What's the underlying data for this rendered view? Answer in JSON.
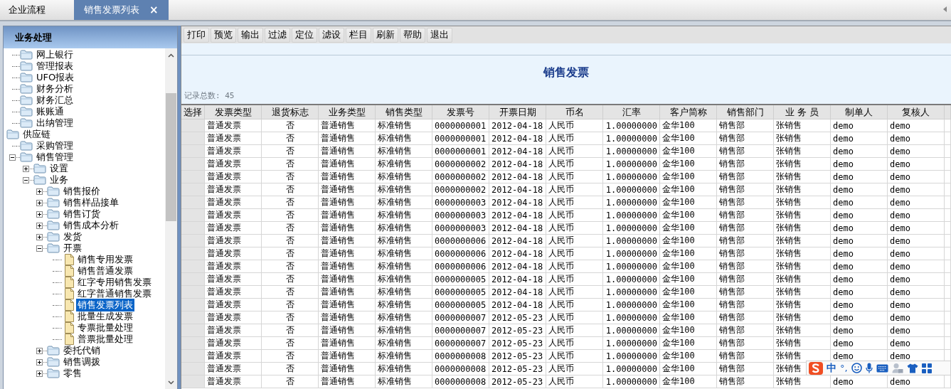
{
  "tabs": [
    {
      "label": "企业流程",
      "selected": false
    },
    {
      "label": "销售发票列表",
      "selected": true,
      "close": "×"
    }
  ],
  "sidebar": {
    "title": "业务处理",
    "continued_items": [
      {
        "label": "网上银行",
        "kind": "folder",
        "selected": false
      },
      {
        "label": "管理报表",
        "kind": "folder",
        "selected": false
      },
      {
        "label": "UFO报表",
        "kind": "folder",
        "selected": false
      },
      {
        "label": "财务分析",
        "kind": "folder",
        "selected": false
      },
      {
        "label": "财务汇总",
        "kind": "folder",
        "selected": false
      },
      {
        "label": "账账通",
        "kind": "folder",
        "selected": false
      },
      {
        "label": "出纳管理",
        "kind": "folder",
        "selected": false
      }
    ],
    "items": [
      {
        "label": "供应链",
        "kind": "folder",
        "selected": false,
        "children": [
          {
            "label": "采购管理",
            "kind": "folder",
            "selected": false
          },
          {
            "label": "销售管理",
            "kind": "folder",
            "selected": false,
            "expanded": true,
            "children": [
              {
                "label": "设置",
                "kind": "folder",
                "selected": false,
                "expanded": false
              },
              {
                "label": "业务",
                "kind": "folder",
                "selected": false,
                "expanded": true,
                "children": [
                  {
                    "label": "销售报价",
                    "kind": "folder",
                    "selected": false,
                    "expanded": false
                  },
                  {
                    "label": "销售样品接单",
                    "kind": "folder",
                    "selected": false,
                    "expanded": false
                  },
                  {
                    "label": "销售订货",
                    "kind": "folder",
                    "selected": false,
                    "expanded": false
                  },
                  {
                    "label": "销售成本分析",
                    "kind": "folder",
                    "selected": false,
                    "expanded": false
                  },
                  {
                    "label": "发货",
                    "kind": "folder",
                    "selected": false,
                    "expanded": false
                  },
                  {
                    "label": "开票",
                    "kind": "folder",
                    "selected": false,
                    "expanded": true,
                    "children": [
                      {
                        "label": "销售专用发票",
                        "kind": "document",
                        "selected": false
                      },
                      {
                        "label": "销售普通发票",
                        "kind": "document",
                        "selected": false
                      },
                      {
                        "label": "红字专用销售发票",
                        "kind": "document",
                        "selected": false
                      },
                      {
                        "label": "红字普通销售发票",
                        "kind": "document",
                        "selected": false
                      },
                      {
                        "label": "销售发票列表",
                        "kind": "document",
                        "selected": true
                      },
                      {
                        "label": "批量生成发票",
                        "kind": "document",
                        "selected": false
                      },
                      {
                        "label": "专票批量处理",
                        "kind": "document",
                        "selected": false
                      },
                      {
                        "label": "普票批量处理",
                        "kind": "document",
                        "selected": false
                      }
                    ]
                  },
                  {
                    "label": "委托代销",
                    "kind": "folder",
                    "selected": false,
                    "expanded": false
                  },
                  {
                    "label": "销售调拨",
                    "kind": "folder",
                    "selected": false,
                    "expanded": false
                  },
                  {
                    "label": "零售",
                    "kind": "folder",
                    "selected": false,
                    "expanded": false
                  }
                ]
              }
            ]
          }
        ]
      }
    ]
  },
  "toolbar": [
    "打印",
    "预览",
    "输出",
    "过滤",
    "定位",
    "滤设",
    "栏目",
    "刷新",
    "帮助",
    "退出"
  ],
  "report": {
    "title": "销售发票",
    "record_count": "记录总数: 45"
  },
  "table": {
    "selector_header": "选择",
    "columns": [
      "发票类型",
      "退货标志",
      "业务类型",
      "销售类型",
      "发票号",
      "开票日期",
      "币名",
      "汇率",
      "客户简称",
      "销售部门",
      "业 务 员",
      "制单人",
      "复核人"
    ],
    "rows": [
      [
        "普通发票",
        "否",
        "普通销售",
        "标准销售",
        "0000000001",
        "2012-04-18",
        "人民币",
        "1.00000000",
        "金华100",
        "销售部",
        "张销售",
        "demo",
        "demo"
      ],
      [
        "普通发票",
        "否",
        "普通销售",
        "标准销售",
        "0000000001",
        "2012-04-18",
        "人民币",
        "1.00000000",
        "金华100",
        "销售部",
        "张销售",
        "demo",
        "demo"
      ],
      [
        "普通发票",
        "否",
        "普通销售",
        "标准销售",
        "0000000001",
        "2012-04-18",
        "人民币",
        "1.00000000",
        "金华100",
        "销售部",
        "张销售",
        "demo",
        "demo"
      ],
      [
        "普通发票",
        "否",
        "普通销售",
        "标准销售",
        "0000000002",
        "2012-04-18",
        "人民币",
        "1.00000000",
        "金华100",
        "销售部",
        "张销售",
        "demo",
        "demo"
      ],
      [
        "普通发票",
        "否",
        "普通销售",
        "标准销售",
        "0000000002",
        "2012-04-18",
        "人民币",
        "1.00000000",
        "金华100",
        "销售部",
        "张销售",
        "demo",
        "demo"
      ],
      [
        "普通发票",
        "否",
        "普通销售",
        "标准销售",
        "0000000002",
        "2012-04-18",
        "人民币",
        "1.00000000",
        "金华100",
        "销售部",
        "张销售",
        "demo",
        "demo"
      ],
      [
        "普通发票",
        "否",
        "普通销售",
        "标准销售",
        "0000000003",
        "2012-04-18",
        "人民币",
        "1.00000000",
        "金华100",
        "销售部",
        "张销售",
        "demo",
        "demo"
      ],
      [
        "普通发票",
        "否",
        "普通销售",
        "标准销售",
        "0000000003",
        "2012-04-18",
        "人民币",
        "1.00000000",
        "金华100",
        "销售部",
        "张销售",
        "demo",
        "demo"
      ],
      [
        "普通发票",
        "否",
        "普通销售",
        "标准销售",
        "0000000003",
        "2012-04-18",
        "人民币",
        "1.00000000",
        "金华100",
        "销售部",
        "张销售",
        "demo",
        "demo"
      ],
      [
        "普通发票",
        "否",
        "普通销售",
        "标准销售",
        "0000000006",
        "2012-04-18",
        "人民币",
        "1.00000000",
        "金华100",
        "销售部",
        "张销售",
        "demo",
        "demo"
      ],
      [
        "普通发票",
        "否",
        "普通销售",
        "标准销售",
        "0000000006",
        "2012-04-18",
        "人民币",
        "1.00000000",
        "金华100",
        "销售部",
        "张销售",
        "demo",
        "demo"
      ],
      [
        "普通发票",
        "否",
        "普通销售",
        "标准销售",
        "0000000006",
        "2012-04-18",
        "人民币",
        "1.00000000",
        "金华100",
        "销售部",
        "张销售",
        "demo",
        "demo"
      ],
      [
        "普通发票",
        "否",
        "普通销售",
        "标准销售",
        "0000000005",
        "2012-04-18",
        "人民币",
        "1.00000000",
        "金华100",
        "销售部",
        "张销售",
        "demo",
        "demo"
      ],
      [
        "普通发票",
        "否",
        "普通销售",
        "标准销售",
        "0000000005",
        "2012-04-18",
        "人民币",
        "1.00000000",
        "金华100",
        "销售部",
        "张销售",
        "demo",
        "demo"
      ],
      [
        "普通发票",
        "否",
        "普通销售",
        "标准销售",
        "0000000005",
        "2012-04-18",
        "人民币",
        "1.00000000",
        "金华100",
        "销售部",
        "张销售",
        "demo",
        "demo"
      ],
      [
        "普通发票",
        "否",
        "普通销售",
        "标准销售",
        "0000000007",
        "2012-05-23",
        "人民币",
        "1.00000000",
        "金华100",
        "销售部",
        "张销售",
        "demo",
        "demo"
      ],
      [
        "普通发票",
        "否",
        "普通销售",
        "标准销售",
        "0000000007",
        "2012-05-23",
        "人民币",
        "1.00000000",
        "金华100",
        "销售部",
        "张销售",
        "demo",
        "demo"
      ],
      [
        "普通发票",
        "否",
        "普通销售",
        "标准销售",
        "0000000007",
        "2012-05-23",
        "人民币",
        "1.00000000",
        "金华100",
        "销售部",
        "张销售",
        "demo",
        "demo"
      ],
      [
        "普通发票",
        "否",
        "普通销售",
        "标准销售",
        "0000000008",
        "2012-05-23",
        "人民币",
        "1.00000000",
        "金华100",
        "销售部",
        "张销售",
        "demo",
        "demo"
      ],
      [
        "普通发票",
        "否",
        "普通销售",
        "标准销售",
        "0000000008",
        "2012-05-23",
        "人民币",
        "1.00000000",
        "金华100",
        "销售部",
        "张销售"
      ],
      [
        "普通发票",
        "否",
        "普通销售",
        "标准销售",
        "0000000008",
        "2012-05-23",
        "人民币",
        "1.00000000",
        "金华100",
        "销售部",
        "张销售",
        "demo",
        "demo"
      ]
    ]
  },
  "ime": {
    "mode": "中",
    "punctuation": "°,"
  }
}
